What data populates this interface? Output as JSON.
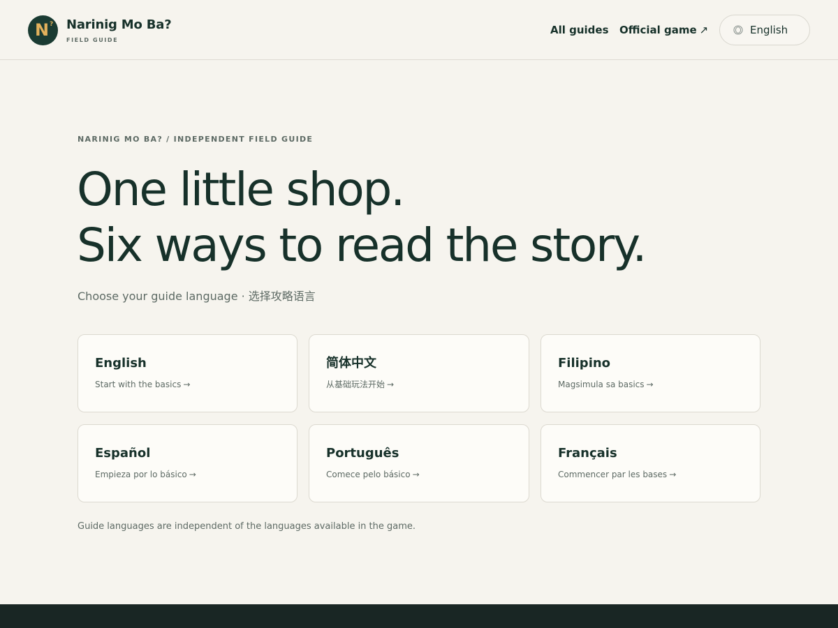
{
  "header": {
    "logo_letter": "N",
    "logo_mark": "?",
    "brand_name": "Narinig Mo Ba?",
    "brand_sub": "FIELD GUIDE",
    "nav": {
      "all_guides": "All guides",
      "official_game": "Official game",
      "official_game_icon": "external-arrow-icon",
      "official_game_arrow": "↗"
    },
    "language_button": {
      "icon": "globe-icon",
      "label": "English"
    }
  },
  "hero": {
    "eyebrow": "NARINIG MO BA? / INDEPENDENT FIELD GUIDE",
    "headline_line1": "One little shop.",
    "headline_line2": "Six ways to read the story.",
    "subline": "Choose your guide language · 选择攻略语言"
  },
  "languages": [
    {
      "title": "English",
      "desc": "Start with the basics"
    },
    {
      "title": "简体中文",
      "desc": "从基础玩法开始"
    },
    {
      "title": "Filipino",
      "desc": "Magsimula sa basics"
    },
    {
      "title": "Español",
      "desc": "Empieza por lo básico"
    },
    {
      "title": "Português",
      "desc": "Comece pelo básico"
    },
    {
      "title": "Français",
      "desc": "Commencer par les bases"
    }
  ],
  "card_arrow": "→",
  "footnote": "Guide languages are independent of the languages available in the game.",
  "colors": {
    "background": "#f6f4ee",
    "ink": "#17312a",
    "muted": "#5d6a64",
    "logo_bg": "#1a3b32",
    "logo_accent": "#e2b15c",
    "card_bg": "#fdfcf8",
    "footer": "#192624"
  }
}
